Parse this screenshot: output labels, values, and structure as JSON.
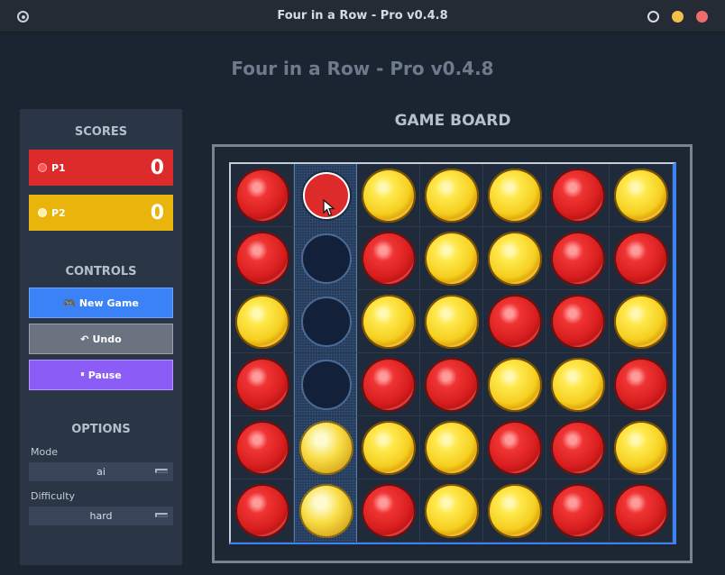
{
  "window": {
    "title": "Four in a Row - Pro v0.4.8"
  },
  "app_title": "Four in a Row - Pro v0.4.8",
  "scores": {
    "heading": "SCORES",
    "p1": {
      "label": "P1",
      "value": "0",
      "color": "#dd2a2a"
    },
    "p2": {
      "label": "P2",
      "value": "0",
      "color": "#e9b40c"
    }
  },
  "controls": {
    "heading": "CONTROLS",
    "new_game": {
      "icon": "🎮",
      "label": "New Game"
    },
    "undo": {
      "icon": "↶",
      "label": "Undo"
    },
    "pause": {
      "icon": "⏸",
      "label": "Pause"
    }
  },
  "options": {
    "heading": "OPTIONS",
    "mode": {
      "label": "Mode",
      "value": "ai"
    },
    "difficulty": {
      "label": "Difficulty",
      "value": "hard"
    }
  },
  "board": {
    "title": "GAME BOARD",
    "highlighted_column": 1,
    "cells": [
      [
        "R",
        "H",
        "Y",
        "Y",
        "Y",
        "R",
        "Y"
      ],
      [
        "R",
        "E",
        "R",
        "Y",
        "Y",
        "R",
        "R"
      ],
      [
        "Y",
        "E",
        "Y",
        "Y",
        "R",
        "R",
        "Y"
      ],
      [
        "R",
        "E",
        "R",
        "R",
        "Y",
        "Y",
        "R"
      ],
      [
        "R",
        "y",
        "Y",
        "Y",
        "R",
        "R",
        "Y"
      ],
      [
        "R",
        "y",
        "R",
        "Y",
        "Y",
        "R",
        "R"
      ]
    ],
    "legend": {
      "R": "red",
      "Y": "yellow",
      "y": "yellow-faded",
      "E": "empty",
      "H": "red-hover"
    }
  }
}
